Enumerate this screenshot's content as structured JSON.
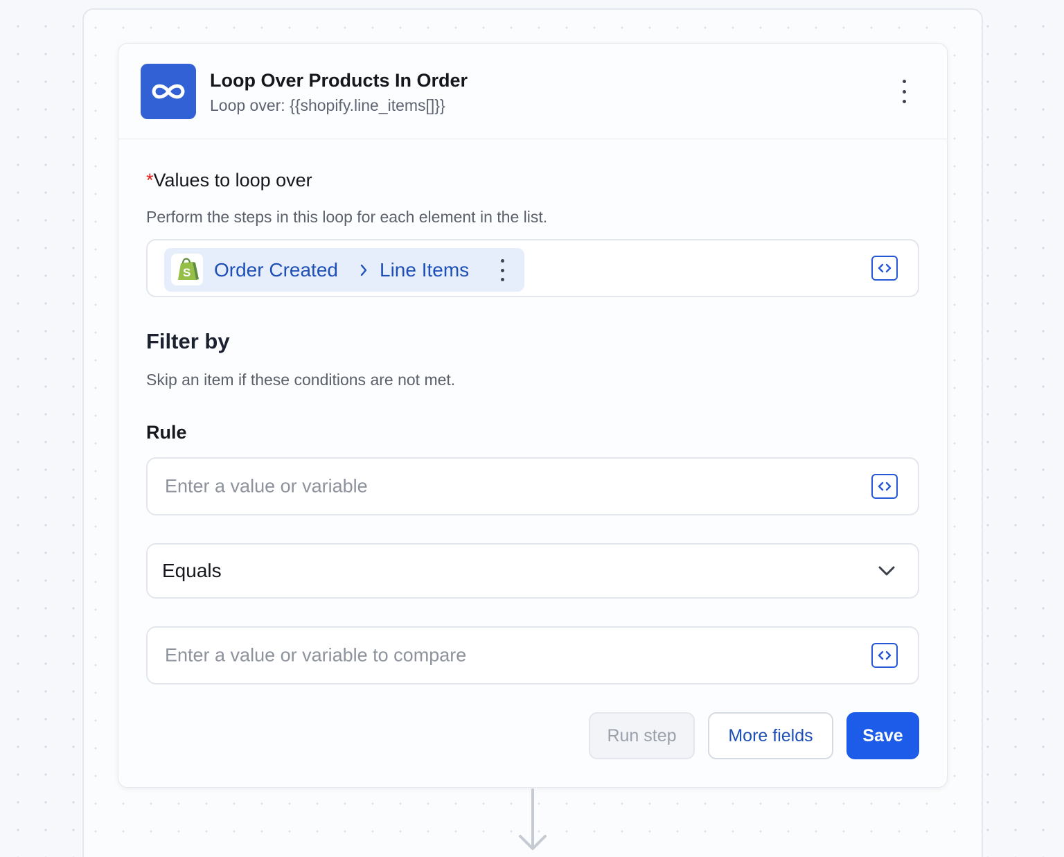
{
  "step": {
    "title": "Loop Over Products In Order",
    "subtitle": "Loop over: {{shopify.line_items[]}}",
    "app_icon": "infinity-loop-icon",
    "menu_icon": "kebab-vertical-icon"
  },
  "loop_values": {
    "required_marker": "*",
    "label": "Values to loop over",
    "description": "Perform the steps in this loop for each element in the list.",
    "pill": {
      "source_icon": "shopify-bag-icon",
      "source": "Order Created",
      "separator_icon": "chevron-right-icon",
      "field": "Line Items"
    }
  },
  "filter": {
    "heading": "Filter by",
    "description": "Skip an item if these conditions are not met.",
    "rule_label": "Rule",
    "value_placeholder": "Enter a value or variable",
    "operator": "Equals",
    "compare_placeholder": "Enter a value or variable to compare"
  },
  "actions": {
    "run_step": "Run step",
    "more_fields": "More fields",
    "save": "Save"
  },
  "colors": {
    "accent": "#1c5ce8",
    "app_icon_bg": "#3161d4",
    "pill_bg": "#e6eefc",
    "required": "#e0201b",
    "shopify_green": "#95bf47"
  }
}
